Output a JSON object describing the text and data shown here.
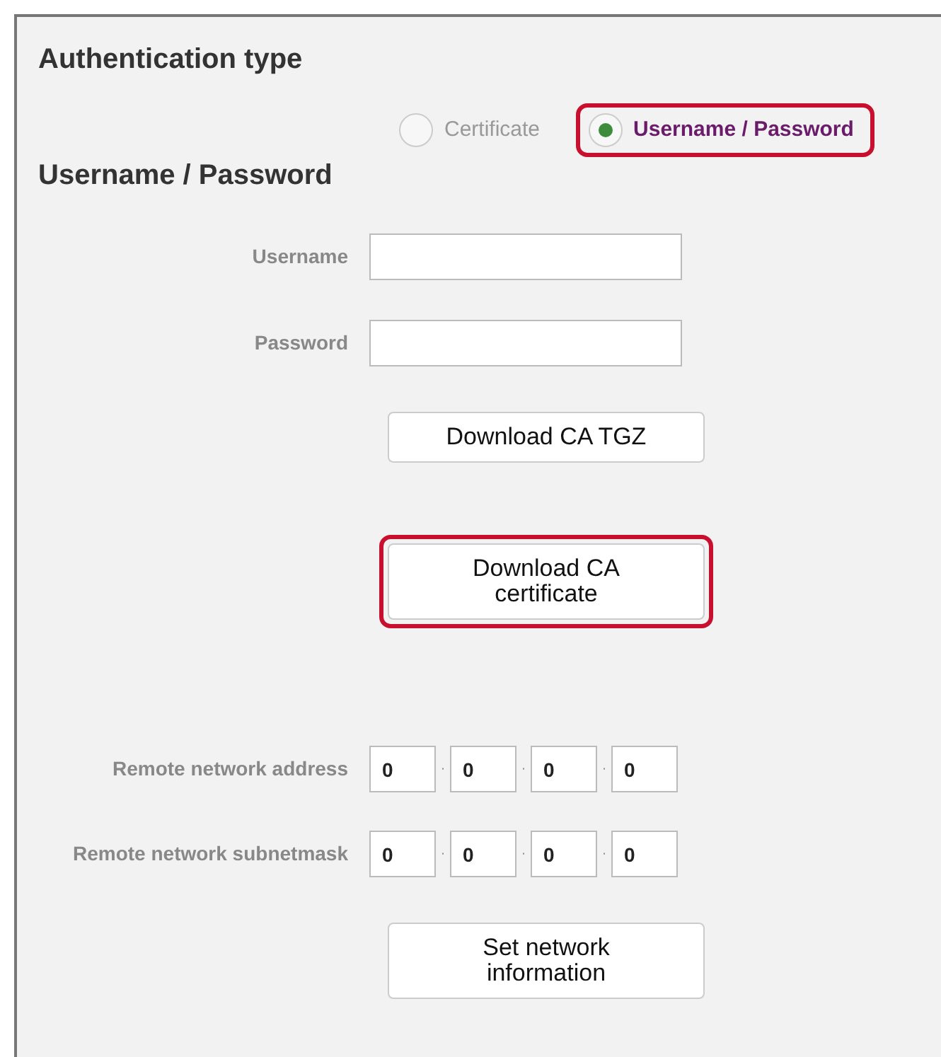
{
  "section_title": "Authentication type",
  "auth_options": [
    {
      "label": "Certificate",
      "selected": false,
      "disabled": true,
      "highlighted": false
    },
    {
      "label": "Username / Password",
      "selected": true,
      "disabled": false,
      "highlighted": true
    }
  ],
  "subsection_title": "Username / Password",
  "form_rows": [
    {
      "kind": "field",
      "label": "Username"
    },
    {
      "kind": "field",
      "label": "Password"
    },
    {
      "kind": "button",
      "label": "Download CA TGZ",
      "highlighted": false
    },
    {
      "kind": "button",
      "label": "Download CA certificate",
      "highlighted": true
    },
    {
      "kind": "ip",
      "label": "Remote network address",
      "separator": "·",
      "octets": [
        "0",
        "0",
        "0",
        "0"
      ]
    },
    {
      "kind": "ip",
      "label": "Remote network subnetmask",
      "separator": "·",
      "octets": [
        "0",
        "0",
        "0",
        "0"
      ]
    },
    {
      "kind": "button",
      "label": "Set network information",
      "highlighted": false
    }
  ]
}
